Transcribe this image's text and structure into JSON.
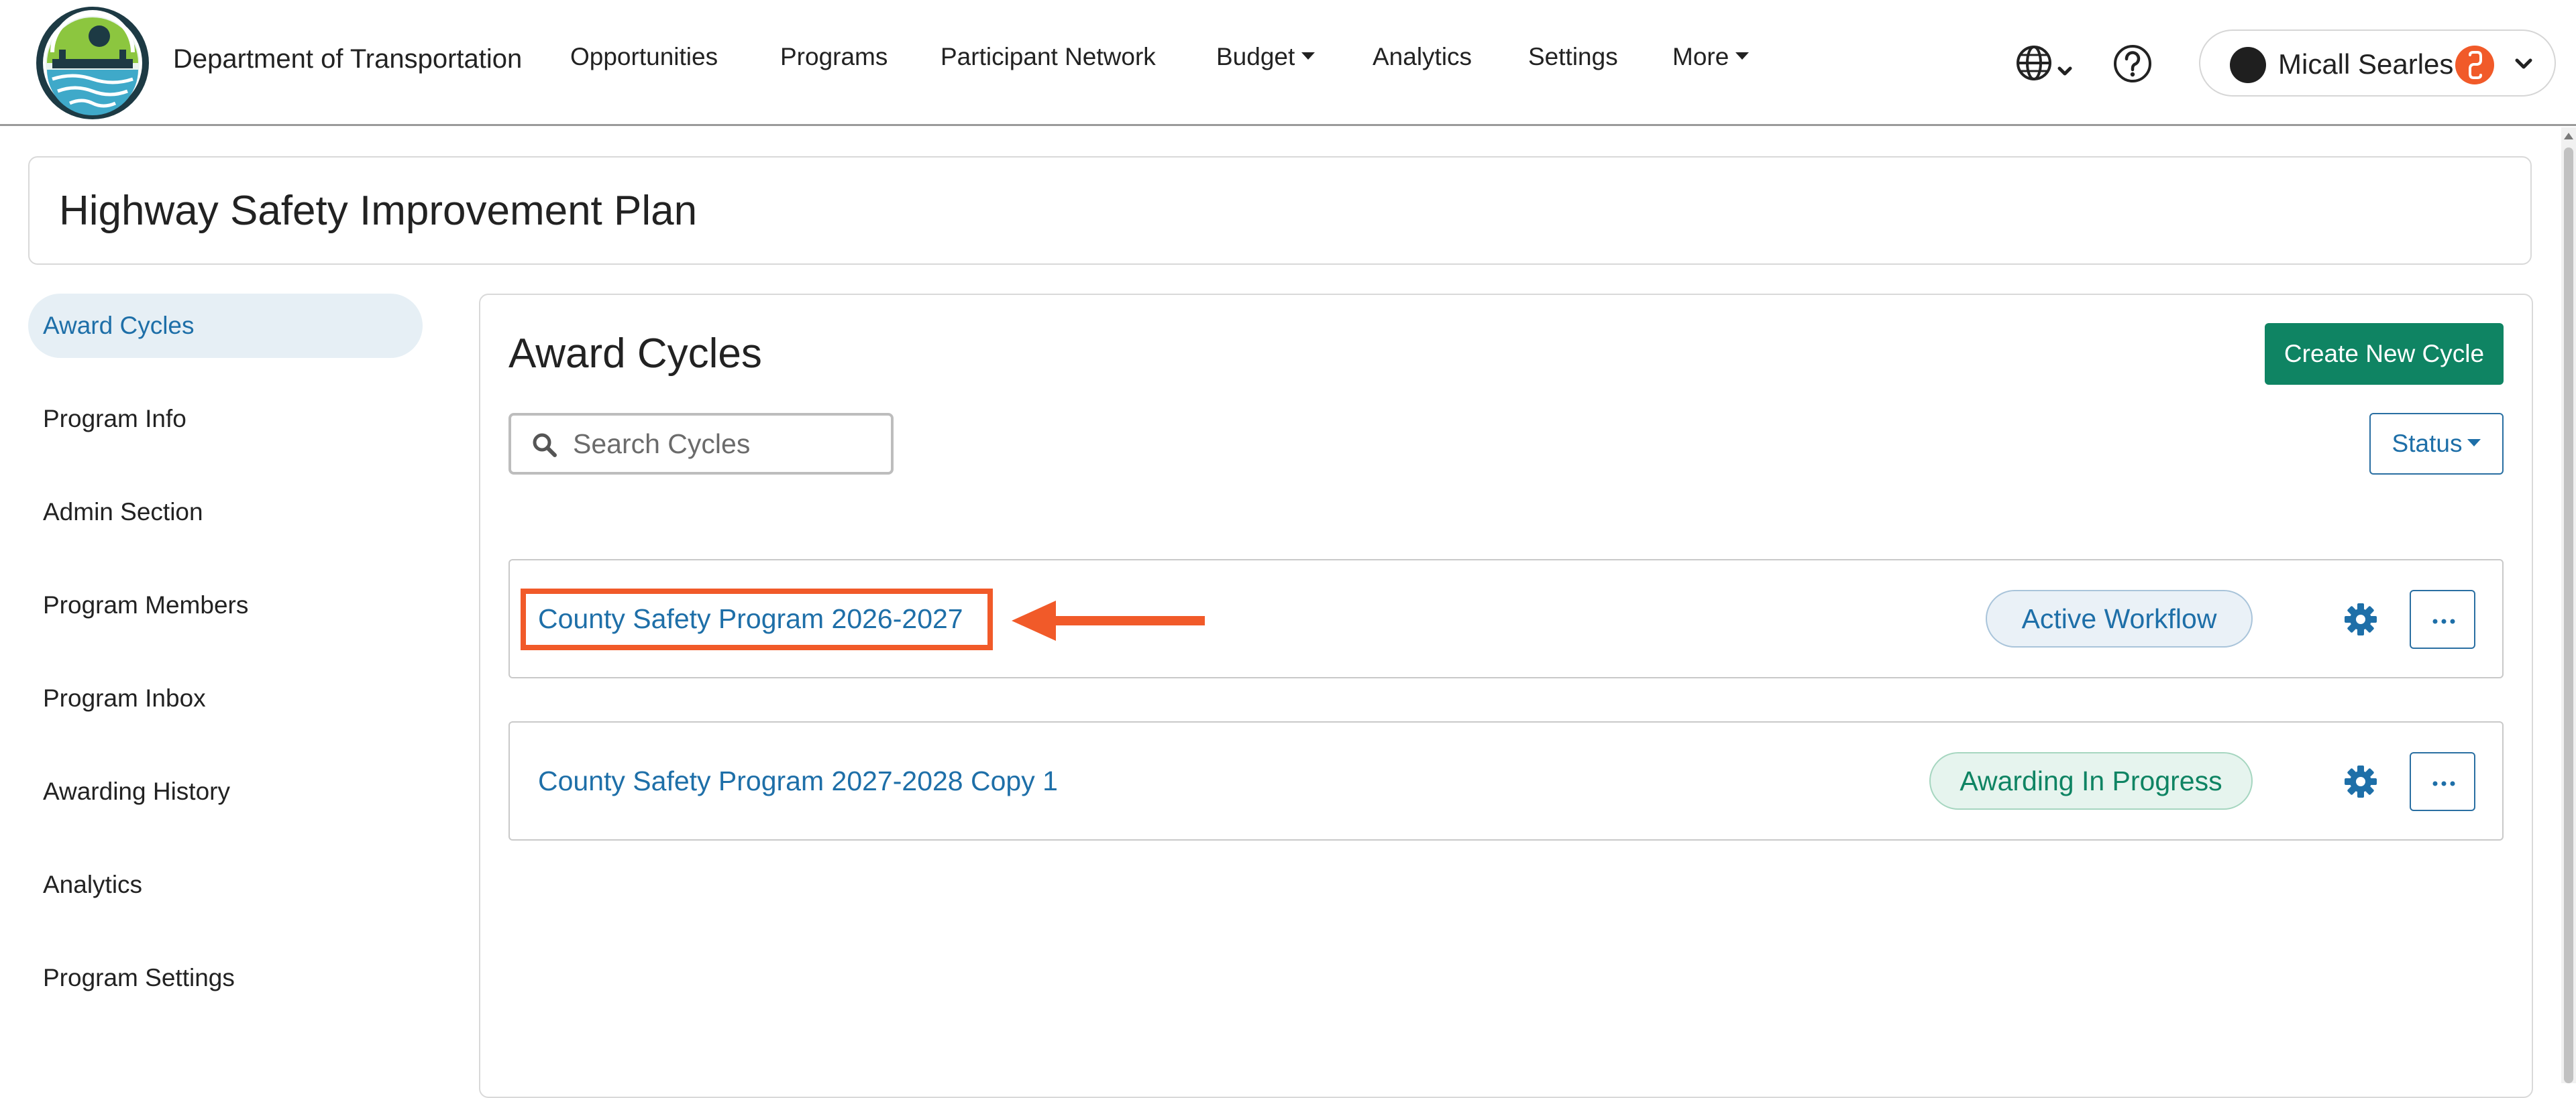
{
  "header": {
    "org_name": "Department of Transportation",
    "nav": [
      {
        "label": "Opportunities"
      },
      {
        "label": "Programs"
      },
      {
        "label": "Participant Network"
      },
      {
        "label": "Budget"
      },
      {
        "label": "Analytics"
      },
      {
        "label": "Settings"
      },
      {
        "label": "More"
      }
    ],
    "icons": [
      "globe-icon",
      "help-icon"
    ],
    "user": {
      "name": "Micall Searles"
    }
  },
  "page_title": "Highway Safety Improvement Plan",
  "sidebar": {
    "items": [
      {
        "label": "Award Cycles",
        "active": true
      },
      {
        "label": "Program Info"
      },
      {
        "label": "Admin Section"
      },
      {
        "label": "Program Members"
      },
      {
        "label": "Program Inbox"
      },
      {
        "label": "Awarding History"
      },
      {
        "label": "Analytics"
      },
      {
        "label": "Program Settings"
      }
    ]
  },
  "main": {
    "title": "Award Cycles",
    "create_label": "Create New Cycle",
    "search_placeholder": "Search Cycles",
    "status_label": "Status",
    "cycles": [
      {
        "name": "County Safety Program 2026-2027",
        "status": "Active Workflow",
        "status_color": "#1e6fa8"
      },
      {
        "name": "County Safety Program 2027-2028 Copy 1",
        "status": "Awarding In Progress",
        "status_color": "#0f8463"
      }
    ]
  },
  "colors": {
    "accent": "#1e6fa8",
    "primary_button": "#0f8463",
    "annotation": "#f15a29"
  }
}
